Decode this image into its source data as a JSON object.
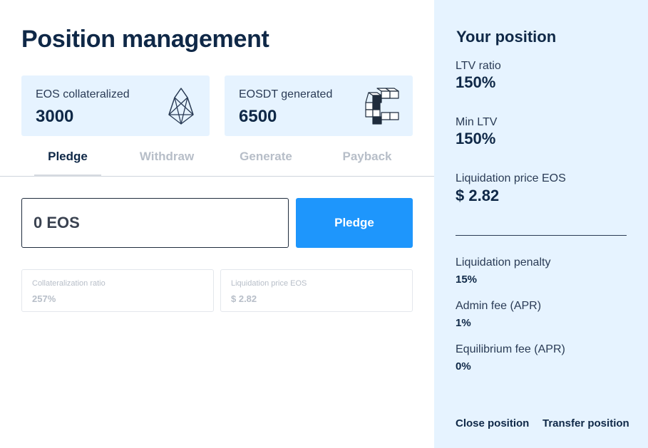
{
  "page": {
    "title": "Position management"
  },
  "stats": {
    "eos": {
      "label": "EOS collateralized",
      "value": "3000"
    },
    "eosdt": {
      "label": "EOSDT generated",
      "value": "6500"
    }
  },
  "tabs": [
    {
      "label": "Pledge",
      "active": true
    },
    {
      "label": "Withdraw",
      "active": false
    },
    {
      "label": "Generate",
      "active": false
    },
    {
      "label": "Payback",
      "active": false
    }
  ],
  "form": {
    "amount_placeholder": "0 EOS",
    "submit_label": "Pledge"
  },
  "info": {
    "ratio": {
      "label": "Collateralization ratio",
      "value": "257%"
    },
    "liquidation": {
      "label": "Liquidation price EOS",
      "value": "$ 2.82"
    }
  },
  "sidebar": {
    "title": "Your position",
    "ltv": {
      "label": "LTV ratio",
      "value": "150%"
    },
    "min_ltv": {
      "label": "Min LTV",
      "value": "150%"
    },
    "liquidation_price": {
      "label": "Liquidation price EOS",
      "value": "$ 2.82"
    },
    "penalty": {
      "label": "Liquidation penalty",
      "value": "15%"
    },
    "admin_fee": {
      "label": "Admin fee (APR)",
      "value": "1%"
    },
    "equilibrium_fee": {
      "label": "Equilibrium fee (APR)",
      "value": "0%"
    },
    "close_label": "Close position",
    "transfer_label": "Transfer position"
  },
  "colors": {
    "navy": "#0f2847",
    "accent_blue": "#1e96fc",
    "panel_bg": "#e6f3ff",
    "muted": "#b7bec8"
  }
}
